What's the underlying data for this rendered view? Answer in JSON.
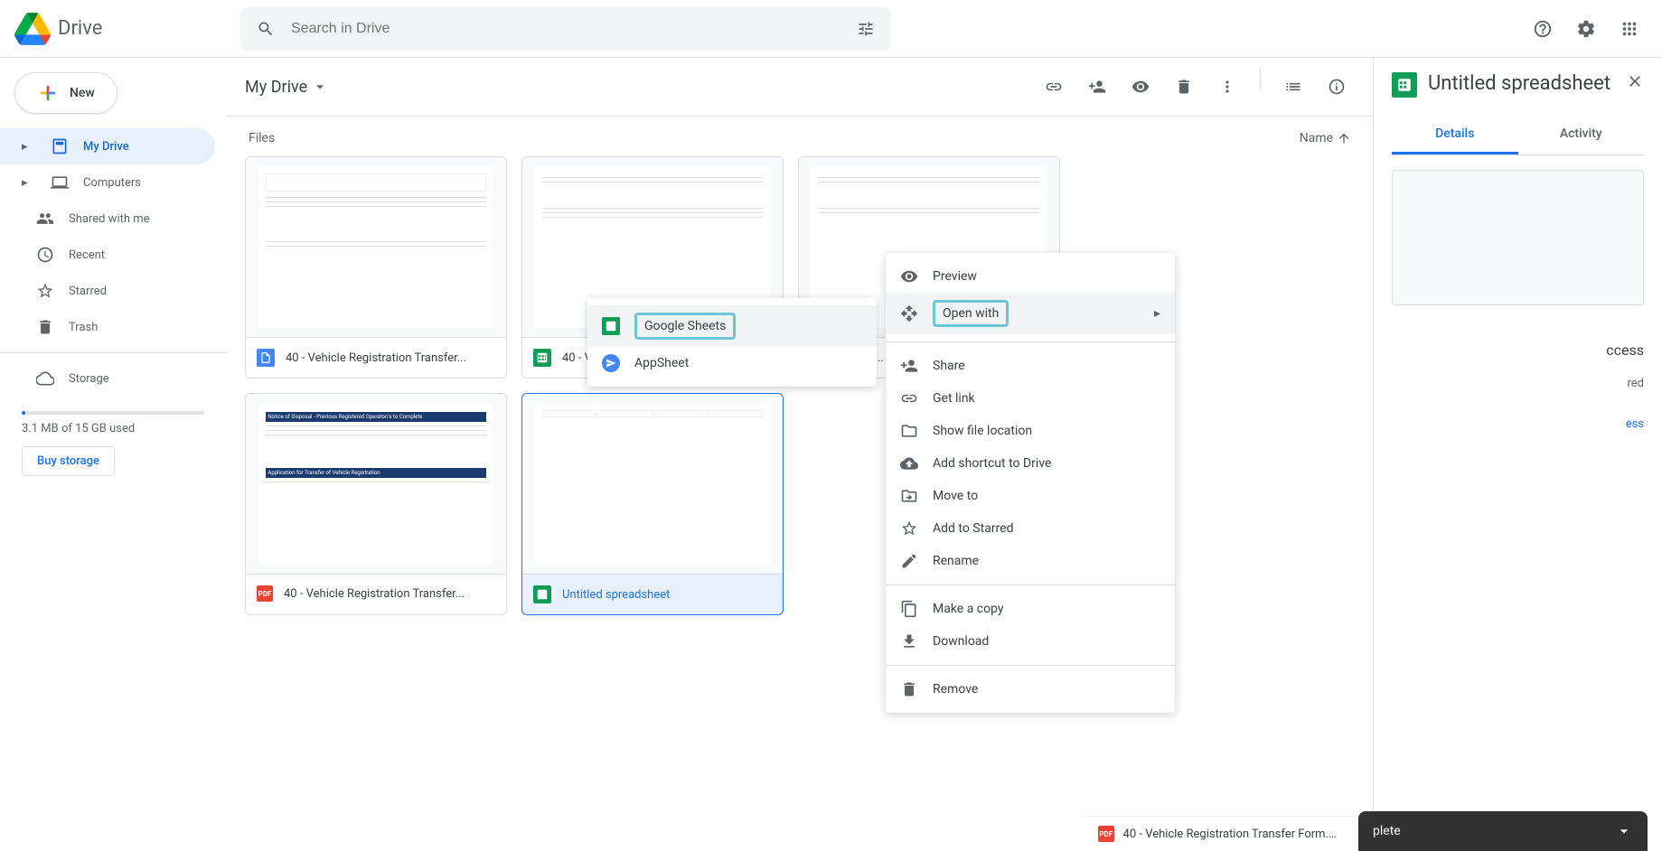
{
  "header": {
    "logo_text": "Drive",
    "search_placeholder": "Search in Drive"
  },
  "sidebar": {
    "new_label": "New",
    "items": [
      {
        "label": "My Drive",
        "icon": "drive"
      },
      {
        "label": "Computers",
        "icon": "laptop"
      },
      {
        "label": "Shared with me",
        "icon": "people"
      },
      {
        "label": "Recent",
        "icon": "clock"
      },
      {
        "label": "Starred",
        "icon": "star"
      },
      {
        "label": "Trash",
        "icon": "trash"
      }
    ],
    "storage_label": "Storage",
    "storage_used": "3.1 MB of 15 GB used",
    "buy_label": "Buy storage"
  },
  "content": {
    "breadcrumb": "My Drive",
    "files_label": "Files",
    "sort_label": "Name"
  },
  "files": [
    {
      "name": "40 - Vehicle Registration Transfer...",
      "type": "docs"
    },
    {
      "name": "40 - Vehicle Registration Transfer...",
      "type": "sheets"
    },
    {
      "name": "40 - Ve...",
      "type": "sheets"
    },
    {
      "name": "40 - Vehicle Registration Transfer...",
      "type": "pdf"
    },
    {
      "name": "Untitled spreadsheet",
      "type": "sheets",
      "selected": true
    }
  ],
  "details": {
    "title": "Untitled spreadsheet",
    "tab_details": "Details",
    "tab_activity": "Activity",
    "access_fragment": "ccess",
    "shared_fragment": "red",
    "link_fragment": "ess",
    "upload_text": "plete",
    "upload_file": "40 - Vehicle Registration Transfer Form.pdf"
  },
  "context_menu": {
    "preview": "Preview",
    "open_with": "Open with",
    "share": "Share",
    "get_link": "Get link",
    "show_location": "Show file location",
    "add_shortcut": "Add shortcut to Drive",
    "move_to": "Move to",
    "add_starred": "Add to Starred",
    "rename": "Rename",
    "make_copy": "Make a copy",
    "download": "Download",
    "remove": "Remove"
  },
  "submenu": {
    "google_sheets": "Google Sheets",
    "appsheet": "AppSheet"
  }
}
